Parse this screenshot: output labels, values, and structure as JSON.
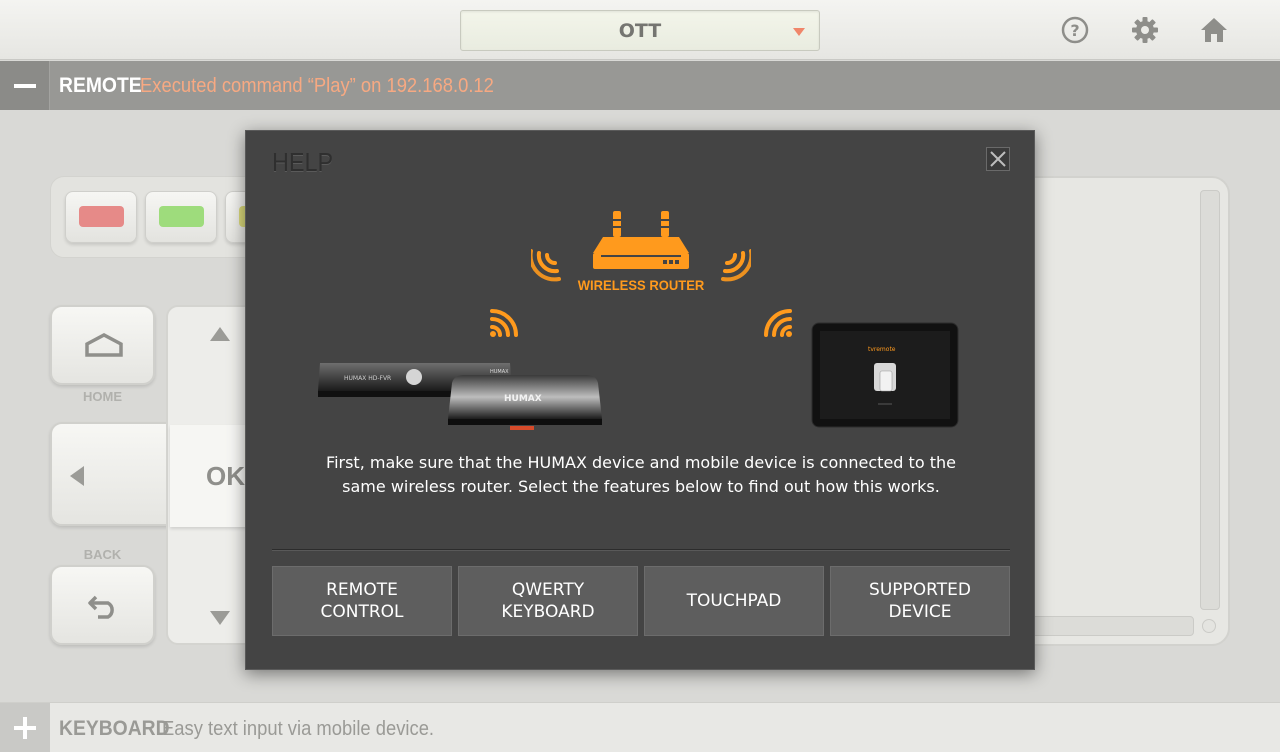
{
  "topbar": {
    "selected_device": "OTT",
    "icons": [
      "help-icon",
      "settings-gear-icon",
      "home-icon"
    ]
  },
  "remote_bar": {
    "title": "REMOTE",
    "status": "Executed command “Play” on 192.168.0.12"
  },
  "remote": {
    "color_buttons": [
      {
        "name": "red",
        "color": "#e68a88"
      },
      {
        "name": "green",
        "color": "#9edc7c"
      },
      {
        "name": "yellow",
        "color": "#d9d87a"
      }
    ],
    "home_label": "HOME",
    "back_label": "BACK",
    "ok_label": "OK"
  },
  "help_dialog": {
    "title": "HELP",
    "router_label": "WIRELESS ROUTER",
    "device_brand": "HUMAX",
    "device_model": "HUMAX HD-FVR",
    "tablet_app": "tvremote",
    "message": "First, make sure that the HUMAX device and mobile device is connected to the same wireless router. Select the features below to find out how this works.",
    "buttons": [
      {
        "label": "REMOTE\nCONTROL"
      },
      {
        "label": "QWERTY\nKEYBOARD"
      },
      {
        "label": "TOUCHPAD"
      },
      {
        "label": "SUPPORTED\nDEVICE"
      }
    ],
    "accent_color": "#ff9a1d"
  },
  "keyboard_bar": {
    "title": "KEYBOARD",
    "description": "Easy text input via mobile device."
  }
}
